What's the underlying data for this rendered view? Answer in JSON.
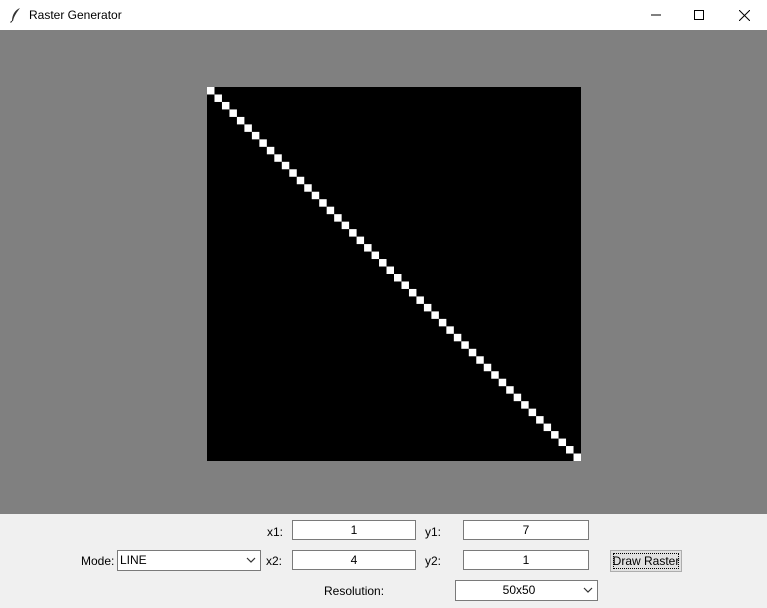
{
  "window": {
    "title": "Raster Generator",
    "icon": "feather-icon",
    "controls": [
      "minimize-icon",
      "maximize-icon",
      "close-icon"
    ]
  },
  "canvas": {
    "background": "#808080",
    "raster_background": "#000000",
    "pixel_color": "#ffffff",
    "resolution": 50,
    "lit_pixels": [
      [
        0,
        0
      ],
      [
        1,
        1
      ],
      [
        2,
        2
      ],
      [
        3,
        3
      ],
      [
        4,
        4
      ],
      [
        5,
        5
      ],
      [
        6,
        6
      ],
      [
        7,
        7
      ],
      [
        8,
        8
      ],
      [
        9,
        9
      ],
      [
        10,
        10
      ],
      [
        11,
        11
      ],
      [
        12,
        12
      ],
      [
        13,
        13
      ],
      [
        14,
        14
      ],
      [
        15,
        15
      ],
      [
        16,
        16
      ],
      [
        17,
        17
      ],
      [
        18,
        18
      ],
      [
        19,
        19
      ],
      [
        20,
        20
      ],
      [
        21,
        21
      ],
      [
        22,
        22
      ],
      [
        23,
        23
      ],
      [
        24,
        24
      ],
      [
        25,
        25
      ],
      [
        26,
        26
      ],
      [
        27,
        27
      ],
      [
        28,
        28
      ],
      [
        29,
        29
      ],
      [
        30,
        30
      ],
      [
        31,
        31
      ],
      [
        32,
        32
      ],
      [
        33,
        33
      ],
      [
        34,
        34
      ],
      [
        35,
        35
      ],
      [
        36,
        36
      ],
      [
        37,
        37
      ],
      [
        38,
        38
      ],
      [
        39,
        39
      ],
      [
        40,
        40
      ],
      [
        41,
        41
      ],
      [
        42,
        42
      ],
      [
        43,
        43
      ],
      [
        44,
        44
      ],
      [
        45,
        45
      ],
      [
        46,
        46
      ],
      [
        47,
        47
      ],
      [
        48,
        48
      ],
      [
        49,
        49
      ]
    ]
  },
  "controls": {
    "x1_label": "x1:",
    "x1_value": "1",
    "y1_label": "y1:",
    "y1_value": "7",
    "mode_label": "Mode:",
    "mode_value": "LINE",
    "x2_label": "x2:",
    "x2_value": "4",
    "y2_label": "y2:",
    "y2_value": "1",
    "draw_button": "Draw Raster",
    "resolution_label": "Resolution:",
    "resolution_value": "50x50"
  }
}
